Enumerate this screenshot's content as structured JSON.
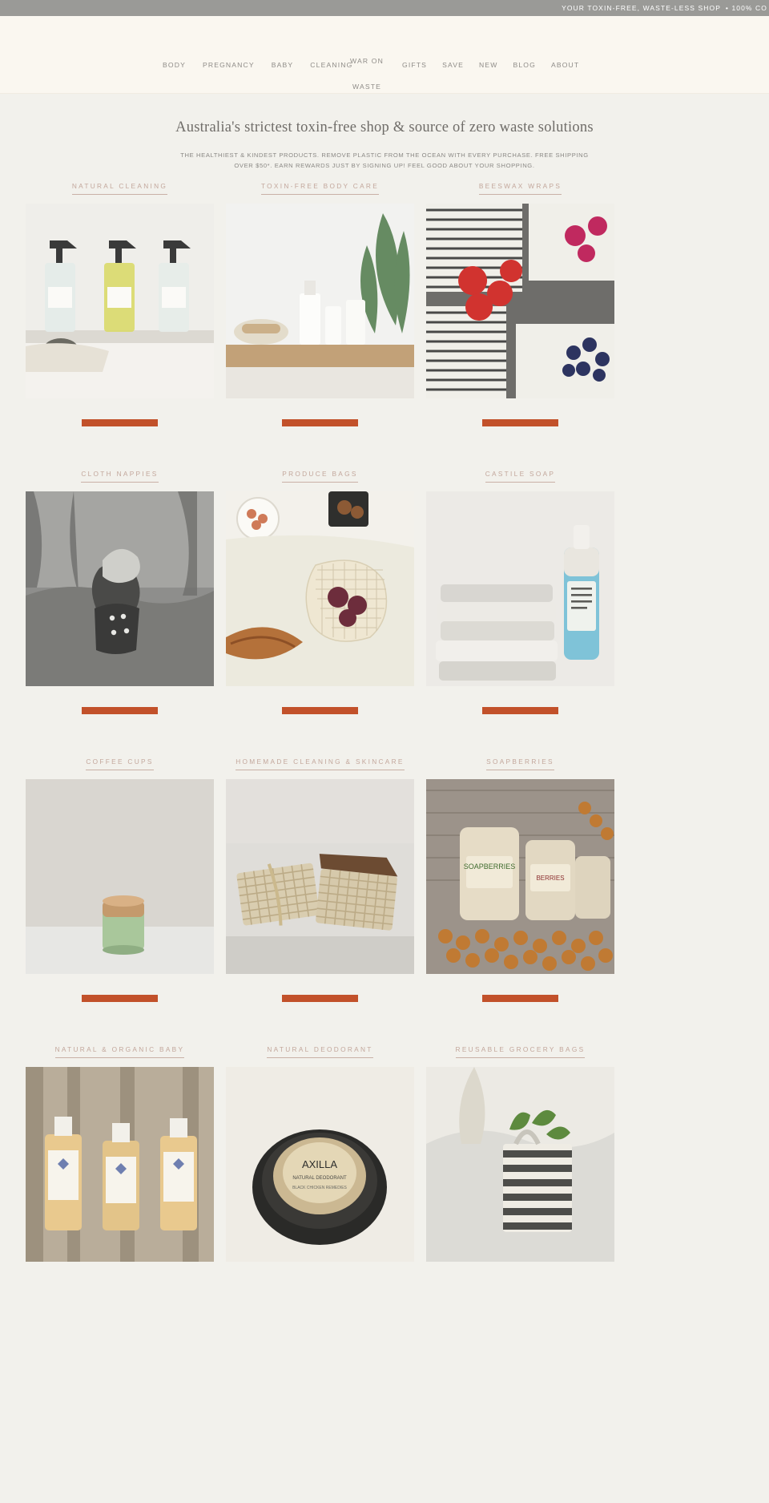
{
  "announcement": {
    "text_primary": "YOUR TOXIN-FREE, WASTE-LESS SHOP",
    "text_overlap": "• 100% CO"
  },
  "nav": {
    "left_items": [
      {
        "label": "BODY"
      },
      {
        "label": "PREGNANCY"
      },
      {
        "label": "BABY"
      },
      {
        "label": "CLEANING"
      }
    ],
    "stacked_item": {
      "line1": "WAR ON",
      "line2": "WASTE"
    },
    "right_items": [
      {
        "label": "GIFTS"
      },
      {
        "label": "SAVE"
      },
      {
        "label": "NEW"
      },
      {
        "label": "BLOG"
      },
      {
        "label": "ABOUT"
      }
    ]
  },
  "intro": {
    "heading": "Australia's strictest toxin-free shop & source of zero waste solutions",
    "paragraph": "THE HEALTHIEST & KINDEST PRODUCTS. REMOVE PLASTIC FROM THE OCEAN WITH EVERY PURCHASE. FREE SHIPPING OVER $50*. EARN REWARDS JUST BY SIGNING UP! FEEL GOOD ABOUT YOUR SHOPPING."
  },
  "categories": [
    {
      "label": "NATURAL CLEANING",
      "image": "spray-bottles-cleaning",
      "cta": true
    },
    {
      "label": "TOXIN-FREE BODY CARE",
      "image": "body-care-bottles-plant",
      "cta": true
    },
    {
      "label": "BEESWAX WRAPS",
      "image": "beeswax-wraps-berries",
      "cta": true
    },
    {
      "label": "CLOTH NAPPIES",
      "image": "baby-cloth-nappy-bw",
      "cta": true
    },
    {
      "label": "PRODUCE BAGS",
      "image": "mesh-produce-bag-bread",
      "cta": true
    },
    {
      "label": "CASTILE SOAP",
      "image": "castile-soap-towels",
      "cta": true
    },
    {
      "label": "COFFEE CUPS",
      "image": "green-ceramic-coffee-cup",
      "cta": true
    },
    {
      "label": "HOMEMADE CLEANING & SKINCARE",
      "image": "handmade-soap-bars-hessian",
      "cta": true
    },
    {
      "label": "SOAPBERRIES",
      "image": "soapberries-sacks",
      "cta": true
    },
    {
      "label": "NATURAL & ORGANIC BABY",
      "image": "baby-lotion-bottles-butterfly",
      "cta": false
    },
    {
      "label": "NATURAL DEODORANT",
      "image": "natural-deodorant-tin",
      "cta": false
    },
    {
      "label": "REUSABLE GROCERY BAGS",
      "image": "striped-grocery-tote-greens",
      "cta": false
    }
  ],
  "colors": {
    "announce_bg": "#9a9a97",
    "header_bg": "#faf7f0",
    "page_bg": "#f2f1ec",
    "label_pink": "#c3a79c",
    "cta_orange": "#c2512a",
    "text_gray": "#8a8884"
  }
}
